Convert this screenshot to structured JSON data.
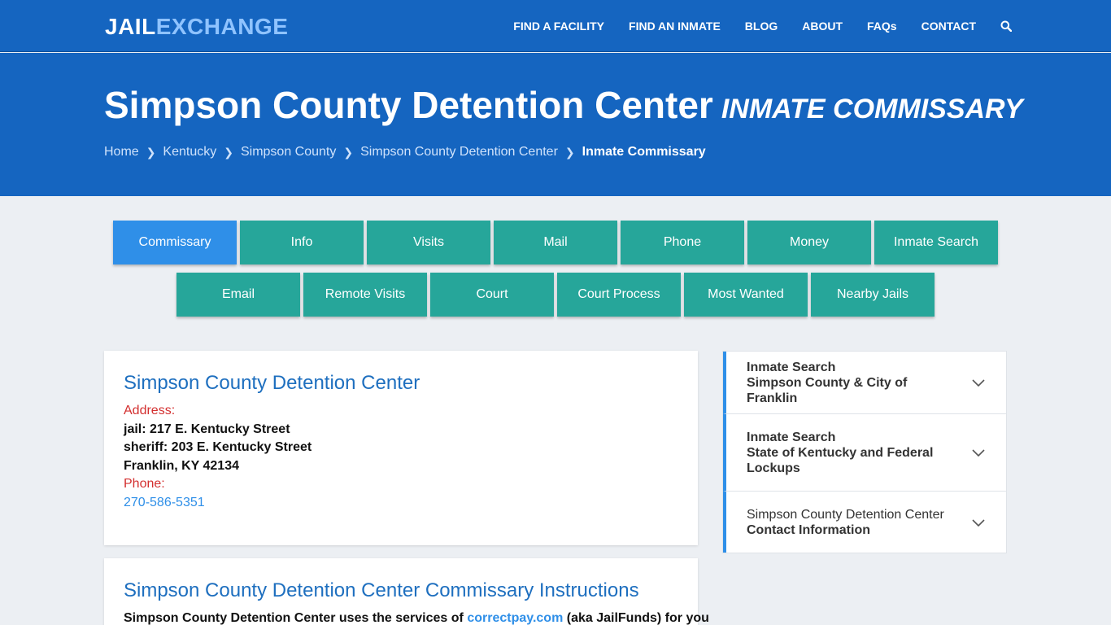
{
  "logo": {
    "part1": "JAIL",
    "part2": "EXCHANGE"
  },
  "nav": {
    "items": [
      "FIND A FACILITY",
      "FIND AN INMATE",
      "BLOG",
      "ABOUT",
      "FAQs",
      "CONTACT"
    ],
    "search_icon": "search-icon"
  },
  "hero": {
    "title": "Simpson County Detention Center",
    "subtitle": "INMATE COMMISSARY",
    "breadcrumb": [
      "Home",
      "Kentucky",
      "Simpson County",
      "Simpson County Detention Center",
      "Inmate Commissary"
    ]
  },
  "tabs": {
    "row1": [
      "Commissary",
      "Info",
      "Visits",
      "Mail",
      "Phone",
      "Money",
      "Inmate Search"
    ],
    "row2": [
      "Email",
      "Remote Visits",
      "Court",
      "Court Process",
      "Most Wanted",
      "Nearby Jails"
    ],
    "active": "Commissary"
  },
  "facility": {
    "name": "Simpson County Detention Center",
    "address_label": "Address:",
    "address_line1": "jail: 217 E. Kentucky Street",
    "address_line2": "sheriff: 203 E. Kentucky Street",
    "address_line3": "Franklin, KY 42134",
    "phone_label": "Phone:",
    "phone": "270-586-5351"
  },
  "instructions": {
    "title": "Simpson County Detention Center Commissary Instructions",
    "text_before": "Simpson County Detention Center uses the services of ",
    "link": "correctpay.com",
    "text_after": " (aka JailFunds) for you"
  },
  "side": {
    "items": [
      {
        "line1": "Inmate Search",
        "line2": "Simpson County & City of Franklin"
      },
      {
        "line1": "Inmate Search",
        "line2": "State of Kentucky and Federal Lockups"
      },
      {
        "line1": "Simpson County Detention Center",
        "line2": "Contact Information"
      }
    ]
  },
  "colors": {
    "primary": "#1565c0",
    "teal": "#26a69a",
    "active": "#2f8fe8",
    "label_red": "#d32f2f"
  }
}
